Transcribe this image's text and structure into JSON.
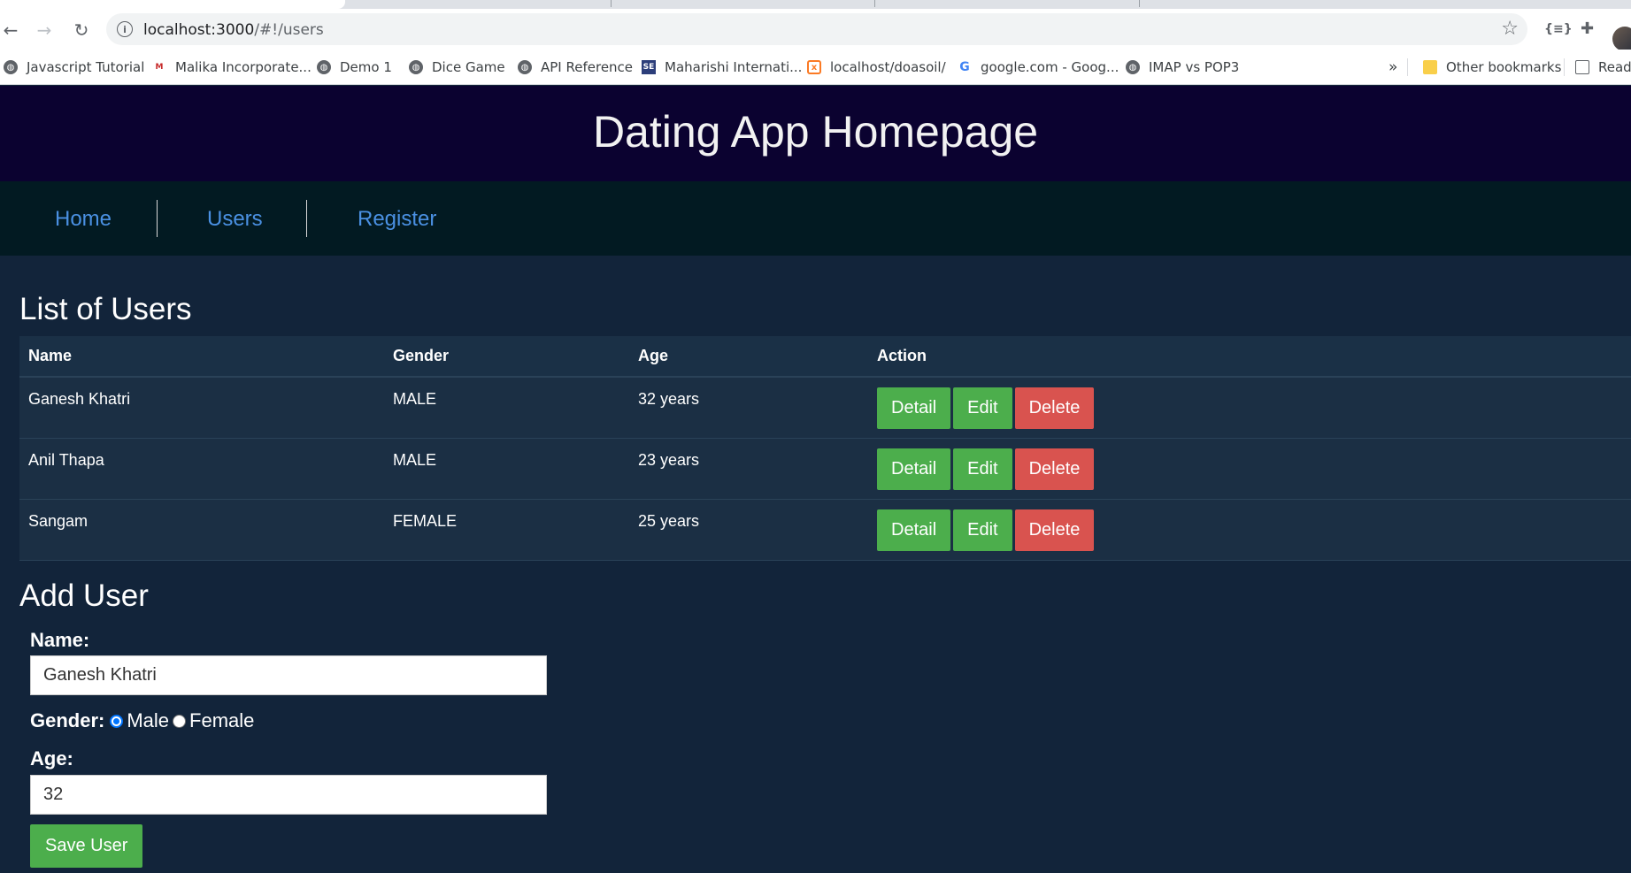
{
  "browser": {
    "url_host": "localhost:3000",
    "url_path": "/#!/users",
    "bookmarks": [
      {
        "label": "Javascript Tutorial",
        "icon": "globe-icon"
      },
      {
        "label": "Malika Incorporate...",
        "icon": "malika-icon"
      },
      {
        "label": "Demo 1",
        "icon": "globe-icon"
      },
      {
        "label": "Dice Game",
        "icon": "globe-icon"
      },
      {
        "label": "API Reference",
        "icon": "globe-icon"
      },
      {
        "label": "Maharishi Internati...",
        "icon": "se-icon"
      },
      {
        "label": "localhost/doasoil/",
        "icon": "xampp-icon"
      },
      {
        "label": "google.com - Goog...",
        "icon": "google-icon"
      },
      {
        "label": "IMAP vs POP3",
        "icon": "globe-icon"
      }
    ],
    "overflow_label": "»",
    "other_bookmarks": "Other bookmarks",
    "reading_list": "Read"
  },
  "header": {
    "title": "Dating App Homepage"
  },
  "nav": {
    "home": "Home",
    "users": "Users",
    "register": "Register"
  },
  "users_section": {
    "title": "List of Users",
    "columns": {
      "name": "Name",
      "gender": "Gender",
      "age": "Age",
      "action": "Action"
    },
    "rows": [
      {
        "name": "Ganesh Khatri",
        "gender": "MALE",
        "age": "32 years"
      },
      {
        "name": "Anil Thapa",
        "gender": "MALE",
        "age": "23 years"
      },
      {
        "name": "Sangam",
        "gender": "FEMALE",
        "age": "25 years"
      }
    ],
    "buttons": {
      "detail": "Detail",
      "edit": "Edit",
      "delete": "Delete"
    }
  },
  "add_user": {
    "title": "Add User",
    "name_label": "Name:",
    "name_value": "Ganesh Khatri",
    "gender_label": "Gender:",
    "gender_options": [
      "Male",
      "Female"
    ],
    "gender_selected": "Male",
    "age_label": "Age:",
    "age_value": "32",
    "save_label": "Save User"
  },
  "colors": {
    "header_bg": "#0b0230",
    "nav_bg": "#021a22",
    "page_bg": "#12243a",
    "link": "#4a90e2",
    "green": "#4cae4c",
    "red": "#d9534f"
  }
}
